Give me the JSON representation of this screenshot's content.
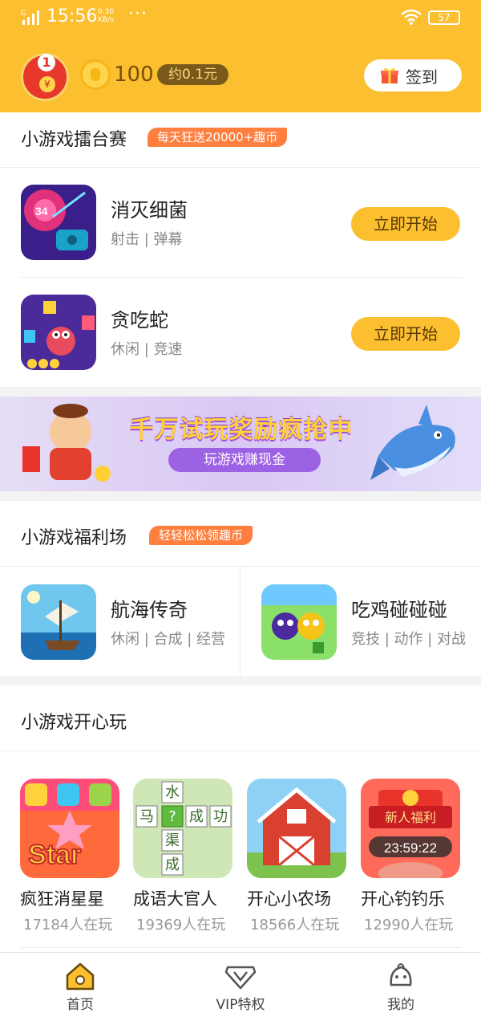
{
  "status_bar": {
    "network": "G",
    "time": "15:56",
    "speed_value": "0.30",
    "speed_unit": "KB/s",
    "more": "···",
    "battery": "57"
  },
  "header": {
    "redpack_badge": "1",
    "redpack_yen": "¥",
    "coin_count": "100",
    "coin_value": "约0.1元",
    "checkin_label": "签到"
  },
  "arena": {
    "title": "小游戏擂台赛",
    "tag": "每天狂送20000+趣币",
    "games": [
      {
        "name": "消灭细菌",
        "tags": "射击 | 弹幕",
        "button": "立即开始"
      },
      {
        "name": "贪吃蛇",
        "tags": "休闲 | 竞速",
        "button": "立即开始"
      }
    ]
  },
  "banner": {
    "title": "千万试玩奖励疯抢中",
    "subtitle": "玩游戏赚现金"
  },
  "welfare": {
    "title": "小游戏福利场",
    "tag": "轻轻松松领趣币",
    "games": [
      {
        "name": "航海传奇",
        "tags": "休闲 | 合成 | 经营"
      },
      {
        "name": "吃鸡碰碰碰",
        "tags": "竞技 | 动作 | 对战"
      }
    ]
  },
  "happy": {
    "title": "小游戏开心玩",
    "games": [
      {
        "name": "疯狂消星星",
        "players": "17184人在玩",
        "icon_text": "Star"
      },
      {
        "name": "成语大官人",
        "players": "19369人在玩",
        "icon_chars": [
          "水",
          "马",
          "?",
          "成",
          "功",
          "渠",
          "成"
        ]
      },
      {
        "name": "开心小农场",
        "players": "18566人在玩"
      },
      {
        "name": "开心钓钓乐",
        "players": "12990人在玩",
        "icon_text": "新人福利",
        "icon_timer": "23:59:22"
      }
    ]
  },
  "nav": {
    "items": [
      {
        "label": "首页",
        "icon": "home-icon",
        "active": true
      },
      {
        "label": "VIP特权",
        "icon": "vip-icon"
      },
      {
        "label": "我的",
        "icon": "profile-icon"
      }
    ]
  },
  "colors": {
    "accent": "#fbbf2f",
    "tag": "#ff7f3f"
  }
}
